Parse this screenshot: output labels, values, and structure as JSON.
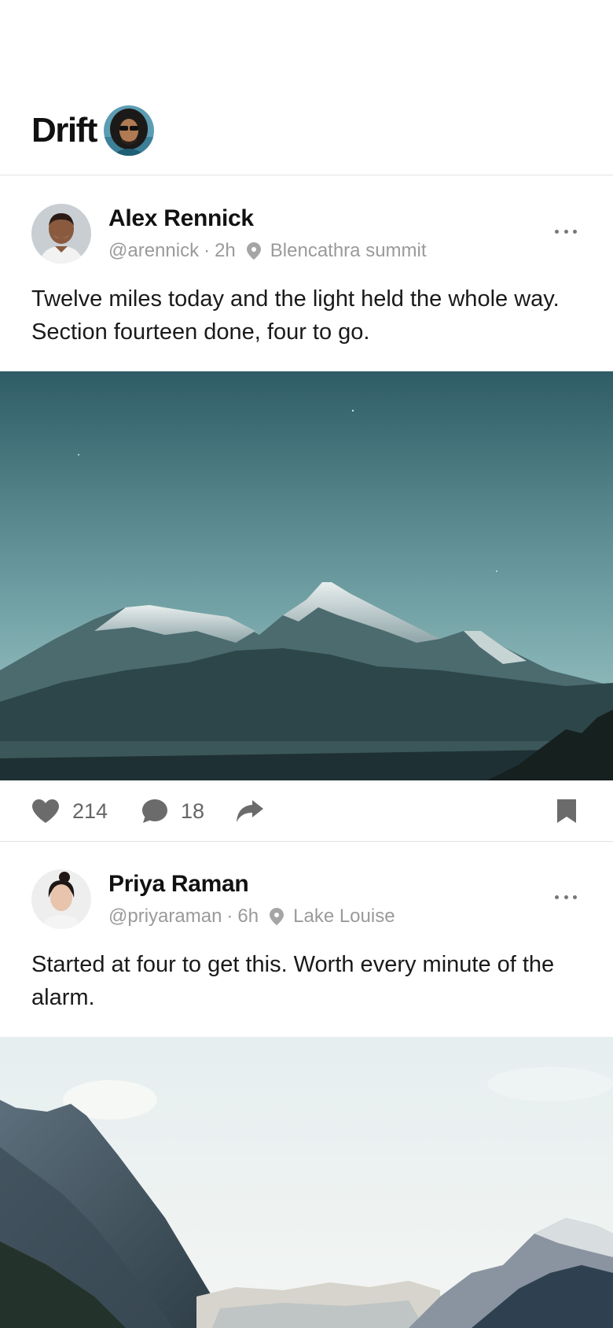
{
  "app": {
    "title": "Drift"
  },
  "posts": [
    {
      "author": "Alex Rennick",
      "handle": "@arennick",
      "time": "2h",
      "location": "Blencathra summit",
      "text": "Twelve miles today and the light held the whole way. Section fourteen done, four to go.",
      "likes": "214",
      "comments": "18"
    },
    {
      "author": "Priya Raman",
      "handle": "@priyaraman",
      "time": "6h",
      "location": "Lake Louise",
      "text": "Started at four to get this. Worth every minute of the alarm."
    }
  ],
  "separator": "·",
  "icons": {
    "like": "heart-icon",
    "comment": "comment-bubble-icon",
    "share": "share-arrow-icon",
    "bookmark": "bookmark-icon",
    "more": "more-dots-icon",
    "location": "location-pin-icon"
  },
  "colors": {
    "text": "#111111",
    "meta": "#9a9a9a",
    "icon": "#6b6b6b",
    "divider": "#e2e2e2"
  }
}
